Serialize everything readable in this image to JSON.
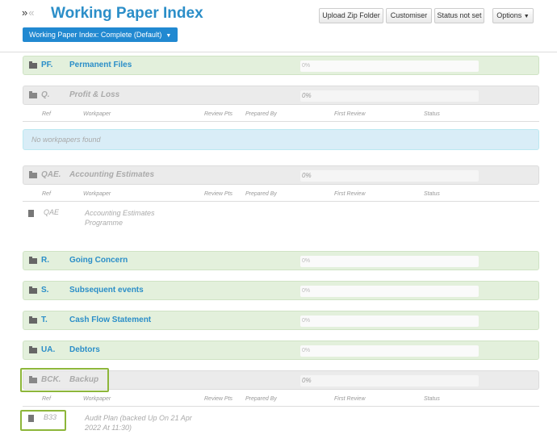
{
  "header": {
    "title": "Working Paper Index",
    "index_dropdown": "Working Paper Index: Complete (Default)",
    "buttons": {
      "upload_zip": "Upload Zip Folder",
      "customiser": "Customiser",
      "status": "Status not set",
      "options": "Options"
    }
  },
  "columns": {
    "ref": "Ref",
    "workpaper": "Workpaper",
    "review_pts": "Review Pts",
    "prepared_by": "Prepared By",
    "first_review": "First Review",
    "status": "Status"
  },
  "sections": [
    {
      "code": "PF.",
      "name": "Permanent Files",
      "progress": "0%",
      "enabled": true
    },
    {
      "code": "Q.",
      "name": "Profit & Loss",
      "progress": "0%",
      "enabled": false
    },
    {
      "code": "QAE.",
      "name": "Accounting Estimates",
      "progress": "0%",
      "enabled": false
    },
    {
      "code": "R.",
      "name": "Going Concern",
      "progress": "0%",
      "enabled": true
    },
    {
      "code": "S.",
      "name": "Subsequent events",
      "progress": "0%",
      "enabled": true
    },
    {
      "code": "T.",
      "name": "Cash Flow Statement",
      "progress": "0%",
      "enabled": true
    },
    {
      "code": "UA.",
      "name": "Debtors",
      "progress": "0%",
      "enabled": true
    },
    {
      "code": "BCK.",
      "name": "Backup",
      "progress": "0%",
      "enabled": false
    }
  ],
  "no_workpapers": "No workpapers found",
  "workpapers": {
    "qae": {
      "ref": "QAE",
      "line1": "Accounting Estimates",
      "line2": "Programme"
    },
    "bck": {
      "ref": "B33",
      "line1": "Audit Plan (backed Up On 21 Apr",
      "line2": "2022 At 11:30)"
    }
  },
  "icons": {
    "collapse": "chevron-double-down-icon",
    "expand": "chevron-double-up-icon",
    "folder": "folder-icon",
    "file": "file-icon",
    "caret": "caret-down-icon"
  },
  "colors": {
    "accent": "#2b8ec8",
    "dropdown_bg": "#2189d1",
    "section_bg": "#e3f0dc",
    "section_disabled_bg": "#ebebeb",
    "info_bg": "#d9edf7",
    "highlight": "#8db63a"
  }
}
